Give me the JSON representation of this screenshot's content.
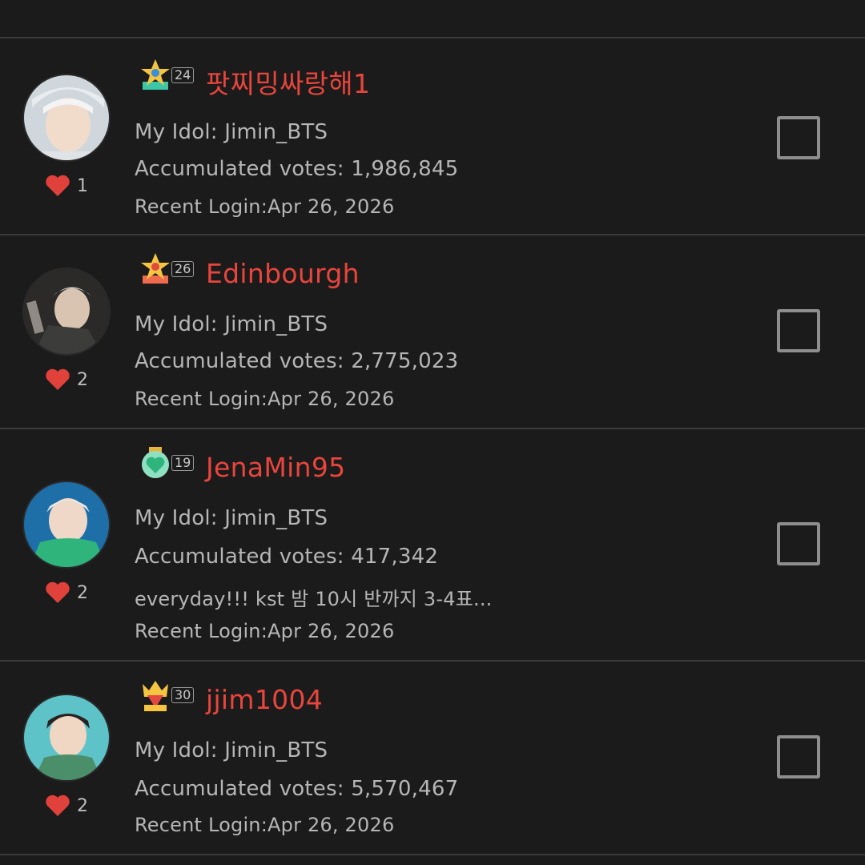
{
  "labels": {
    "idol_prefix": "My Idol: ",
    "votes_prefix": "Accumulated votes: ",
    "login_prefix": "Recent Login:"
  },
  "colors": {
    "username": "#e8453c",
    "heart": "#e0413a",
    "background": "#1b1b1b"
  },
  "users": [
    {
      "badge_icon": "star-trophy-icon",
      "level": "24",
      "username": "팟찌밍싸랑해1",
      "idol": "Jimin_BTS",
      "votes": "1,986,845",
      "status": "",
      "login": "Apr 26, 2026",
      "likes": "1",
      "checked": false
    },
    {
      "badge_icon": "star-trophy-icon",
      "level": "26",
      "username": "Edinbourgh",
      "idol": "Jimin_BTS",
      "votes": "2,775,023",
      "status": "",
      "login": "Apr 26, 2026",
      "likes": "2",
      "checked": false
    },
    {
      "badge_icon": "heart-medal-icon",
      "level": "19",
      "username": "JenaMin95",
      "idol": "Jimin_BTS",
      "votes": "417,342",
      "status": "everyday!!! kst 밤 10시 반까지  3-4표...",
      "login": "Apr 26, 2026",
      "likes": "2",
      "checked": false
    },
    {
      "badge_icon": "crown-gem-icon",
      "level": "30",
      "username": "jjim1004",
      "idol": "Jimin_BTS",
      "votes": "5,570,467",
      "status": "",
      "login": "Apr 26, 2026",
      "likes": "2",
      "checked": false
    }
  ]
}
